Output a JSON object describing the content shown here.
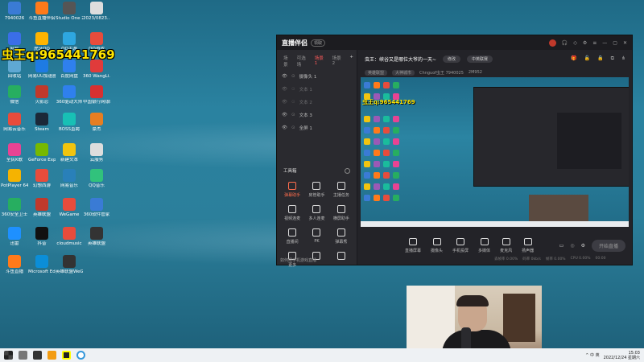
{
  "overlay_text": "虫王q:965441769",
  "desktop_icons": [
    {
      "label": "7940026",
      "color": "#3a7bd5"
    },
    {
      "label": "斗鱼直播伴侣",
      "color": "#ff7a1a"
    },
    {
      "label": "Studio One 2",
      "color": "#555"
    },
    {
      "label": "2023/0823...",
      "color": "#ddd"
    },
    {
      "label": "网易",
      "color": "#3a6ee8"
    },
    {
      "label": "虎牙QQ",
      "color": "#ffb400"
    },
    {
      "label": "QQ手游",
      "color": "#2ea7e0"
    },
    {
      "label": "QQ游戏",
      "color": "#e74c3c"
    },
    {
      "label": "回收站",
      "color": "#5fa8d3"
    },
    {
      "label": "网易UU加速器",
      "color": "#1e7be3"
    },
    {
      "label": "百度网盘",
      "color": "#2f80ed"
    },
    {
      "label": "360 WangLi...",
      "color": "#e03b3b"
    },
    {
      "label": "微信",
      "color": "#27ae60"
    },
    {
      "label": "火影忍",
      "color": "#c0392b"
    },
    {
      "label": "360驱动大师",
      "color": "#2f80ed"
    },
    {
      "label": "中国银行网银助手",
      "color": "#d63031"
    },
    {
      "label": "网易云音乐",
      "color": "#e74c3c"
    },
    {
      "label": "Steam",
      "color": "#1b2838"
    },
    {
      "label": "BOSS直聘",
      "color": "#18c0b5"
    },
    {
      "label": "豪杰",
      "color": "#e67e22"
    },
    {
      "label": "全民K歌",
      "color": "#e84393"
    },
    {
      "label": "GeForce Experience",
      "color": "#76b900"
    },
    {
      "label": "新建文本",
      "color": "#f1c40f"
    },
    {
      "label": "云服务",
      "color": "#ddd"
    },
    {
      "label": "PotPlayer 64 bit",
      "color": "#f5b301"
    },
    {
      "label": "幻想西游",
      "color": "#e74c3c"
    },
    {
      "label": "网易音乐",
      "color": "#2980b9"
    },
    {
      "label": "QQ音乐",
      "color": "#31c27c"
    },
    {
      "label": "360安全卫士",
      "color": "#27ae60"
    },
    {
      "label": "英雄联盟",
      "color": "#c0392b"
    },
    {
      "label": "WeGame",
      "color": "#e74c3c"
    },
    {
      "label": "360软件管家",
      "color": "#3a7bd5"
    },
    {
      "label": "迅雷",
      "color": "#1e90ff"
    },
    {
      "label": "抖音",
      "color": "#111"
    },
    {
      "label": "cloudmusic",
      "color": "#e74c3c"
    },
    {
      "label": "英雄联盟",
      "color": "#333"
    },
    {
      "label": "斗鱼直播",
      "color": "#ff7a1a"
    },
    {
      "label": "Microsoft Edge",
      "color": "#0b8ed8"
    },
    {
      "label": "英雄联盟WeGame版",
      "color": "#333"
    }
  ],
  "app": {
    "brand": "直播伴侣",
    "badge": "领取",
    "title_icons": [
      "avatar",
      "headset",
      "diamond",
      "settings",
      "menu",
      "minimize",
      "maximize",
      "close"
    ],
    "scene_tabs": [
      "场景",
      "可选场",
      "场景 1",
      "场景 2"
    ],
    "sources": [
      {
        "label": "摄像头 1"
      },
      {
        "label": "文本 1"
      },
      {
        "label": "文本 2"
      },
      {
        "label": "文本 3"
      },
      {
        "label": "全屏 1"
      }
    ],
    "tools_title": "工具箱",
    "tools": [
      {
        "label": "弹幕助手",
        "hot": true
      },
      {
        "label": "房管助手",
        "hot": false
      },
      {
        "label": "主播任务",
        "hot": false
      },
      {
        "label": "视频连麦",
        "hot": false
      },
      {
        "label": "多人连麦",
        "hot": false
      },
      {
        "label": "横屏助手",
        "hot": false
      },
      {
        "label": "直播间",
        "hot": false
      },
      {
        "label": "PK",
        "hot": false
      },
      {
        "label": "弹幕秀",
        "hot": false
      },
      {
        "label": "更多",
        "hot": false
      },
      {
        "label": "",
        "hot": false
      },
      {
        "label": "",
        "hot": false
      }
    ],
    "left_footer": "如何把手机游戏直播",
    "room_title": "虫王：峡谷又是哪位大爷的一天~",
    "edit_label": "修改",
    "category_pill": "中英联赛",
    "topbar_icons": [
      "gift",
      "lock",
      "lock2",
      "copy",
      "share"
    ],
    "subbar": {
      "tag1": "英雄联盟",
      "tag2": "大神城市",
      "room_id": "Chnguof虫王 7940025",
      "hot_value": "2M952"
    },
    "preview_text": "虫王q:965441769",
    "bottom_items": [
      "直播屏幕",
      "摄像头",
      "手机投屏",
      "多媒体",
      "麦克风",
      "扬声器"
    ],
    "start_label": "开始直播",
    "stats": [
      "丢帧率 0.00%",
      "码率 0kb/s",
      "帧率 0.00%",
      "CPU 0.00%",
      "00:00"
    ]
  },
  "taskbar": {
    "icons": [
      "start",
      "file-explorer",
      "app",
      "media",
      "app2",
      "obs"
    ],
    "tray": "^ 中 英",
    "time": "15:03",
    "date": "2022/12/24 星期六"
  }
}
